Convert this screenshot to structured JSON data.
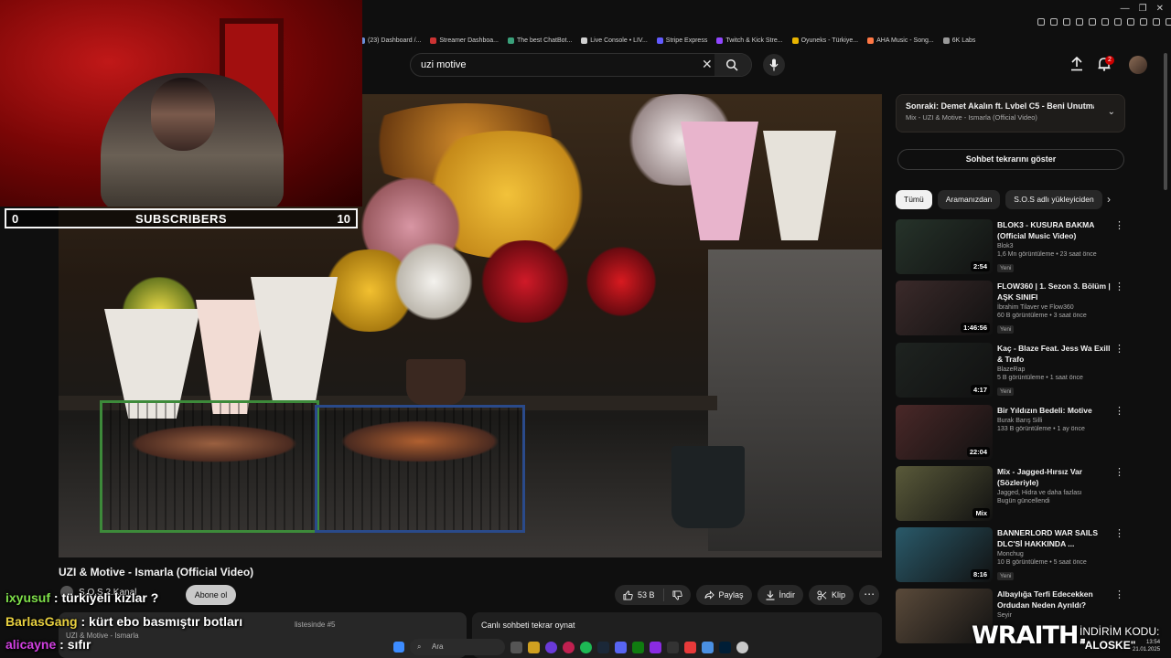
{
  "bookmarks": [
    {
      "label": "(23) Dashboard /...",
      "color": "#6a8fd8"
    },
    {
      "label": "Streamer Dashboa...",
      "color": "#cc3333"
    },
    {
      "label": "The best ChatBot...",
      "color": "#3aa07a"
    },
    {
      "label": "Live Console • LIV...",
      "color": "#d0d0d0"
    },
    {
      "label": "Stripe Express",
      "color": "#635bff"
    },
    {
      "label": "Twitch & Kick Stre...",
      "color": "#9147ff"
    },
    {
      "label": "Oyuneks - Türkiye...",
      "color": "#e8b400"
    },
    {
      "label": "AHA Music - Song...",
      "color": "#ff7744"
    },
    {
      "label": "6K Labs",
      "color": "#999999"
    }
  ],
  "search": {
    "query": "uzi motive"
  },
  "notifications": {
    "count": "2"
  },
  "stream_overlay": {
    "subscriber_goal": {
      "current": "0",
      "label": "SUBSCRIBERS",
      "target": "10",
      "progress": 0
    }
  },
  "video": {
    "title": "UZI & Motive - Ismarla (Official Video)",
    "channel": "S.O.S 2.Kanal",
    "subscribe_label": "Abone ol",
    "likes": "53 B",
    "share_label": "Paylaş",
    "download_label": "İndir",
    "clip_label": "Klip",
    "description_snippet": "UZI & Motive - Ismarla",
    "playlist_note": "listesinde #5",
    "chat_replay_label": "Canlı sohbeti tekrar oynat"
  },
  "sidebar": {
    "next_up_title": "Sonraki: Demet Akalın ft. Lvbel C5 - Beni Unutma (O...",
    "next_up_subtitle": "Mix - UZI & Motive - Ismarla (Official Video)",
    "chat_replay_button": "Sohbet tekrarını göster",
    "chips": [
      "Tümü",
      "Aramanızdan",
      "S.O.S adlı yükleyiciden"
    ],
    "recommendations": [
      {
        "title": "BLOK3 - KUSURA BAKMA (Official Music Video)",
        "channel": "Blok3",
        "meta": "1,6 Mn görüntüleme • 23 saat önce",
        "badge": "Yeni",
        "duration": "2:54",
        "thumb": "#26332a"
      },
      {
        "title": "FLOW360 | 1. Sezon 3. Bölüm | AŞK SINIFI",
        "channel": "İbrahim Tilaver ve Flow360",
        "meta": "60 B görüntüleme • 3 saat önce",
        "badge": "Yeni",
        "duration": "1:46:56",
        "thumb": "#3b2a2a"
      },
      {
        "title": "Kaç - Blaze Feat. Jess Wa Exill & Trafo",
        "channel": "BlazeRap",
        "meta": "5 B görüntüleme • 1 saat önce",
        "badge": "Yeni",
        "duration": "4:17",
        "thumb": "#1e2320"
      },
      {
        "title": "Bir Yıldızın Bedeli: Motive",
        "channel": "Burak Barış Silli",
        "meta": "133 B görüntüleme • 1 ay önce",
        "badge": "",
        "duration": "22:04",
        "thumb": "#4a2828"
      },
      {
        "title": "Mix - Jagged-Hırsız Var (Sözleriyle)",
        "channel": "Jagged, Hidra ve daha fazlası",
        "meta": "Bugün güncellendi",
        "badge": "",
        "duration": "Mix",
        "thumb": "#5a5a3a"
      },
      {
        "title": "BANNERLORD WAR SAILS DLC'Sİ HAKKINDA ...",
        "channel": "Monchug",
        "meta": "10 B görüntüleme • 5 saat önce",
        "badge": "Yeni",
        "duration": "8:16",
        "thumb": "#2a5a6a"
      },
      {
        "title": "Albaylığa Terfi Edecekken Ordudan Neden Ayrıldı?",
        "channel": "Seyir",
        "meta": "",
        "badge": "",
        "duration": "",
        "thumb": "#5a4a3a"
      }
    ]
  },
  "chat": [
    {
      "user": "ixyusuf",
      "message": "türkiyeli kızlar ?",
      "color": "#7fe04a"
    },
    {
      "user": "BarlasGang",
      "message": "kürt ebo basmıştır botları",
      "color": "#e8d040"
    },
    {
      "user": "alicayne",
      "message": "sıfır",
      "color": "#d040e0"
    }
  ],
  "taskbar": {
    "search_placeholder": "Ara",
    "time": "13:54",
    "date": "21.01.2025"
  },
  "sponsor": {
    "brand": "WRAITH.",
    "promo_line1": "İNDİRİM KODU:",
    "promo_code": "\"ALOSKE\""
  }
}
